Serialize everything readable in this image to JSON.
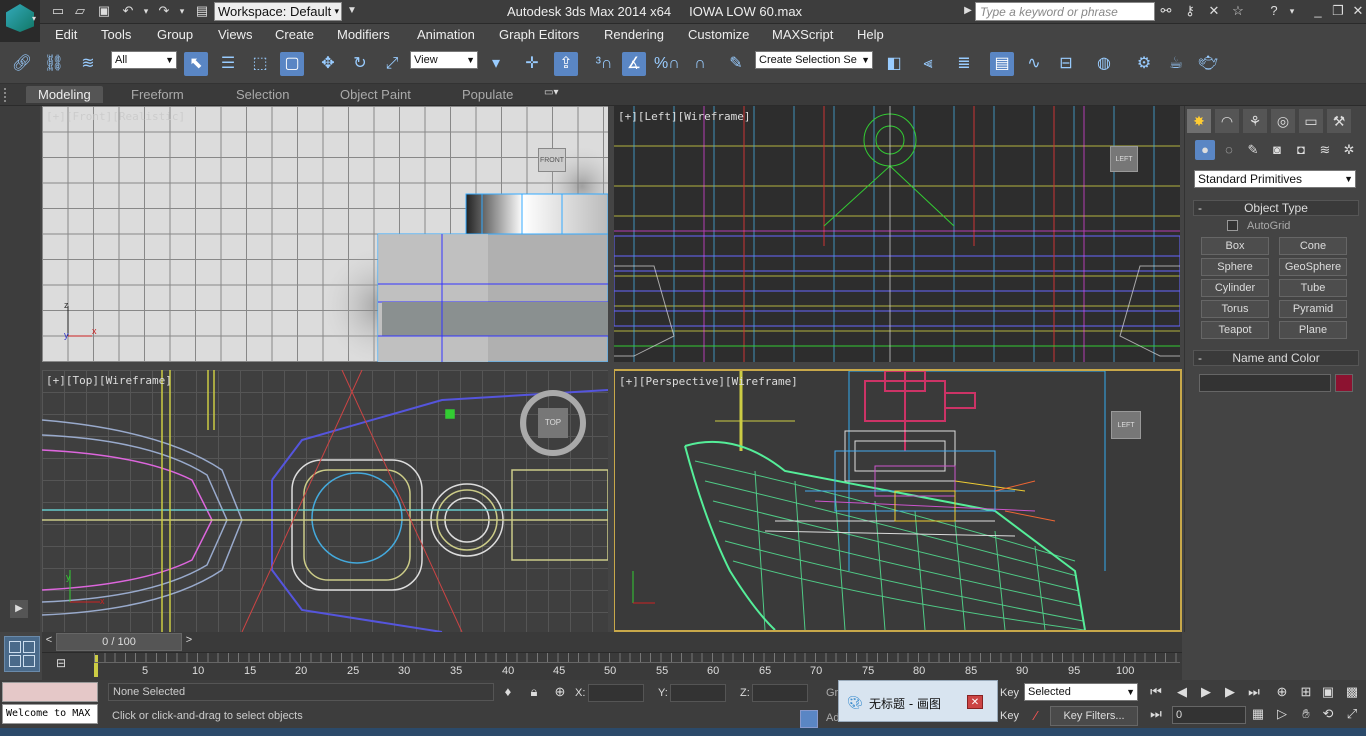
{
  "titlebar": {
    "workspace": "Workspace: Default",
    "app_title": "Autodesk 3ds Max  2014 x64",
    "file_name": "IOWA LOW 60.max",
    "search_placeholder": "Type a keyword or phrase"
  },
  "menu": [
    "Edit",
    "Tools",
    "Group",
    "Views",
    "Create",
    "Modifiers",
    "Animation",
    "Graph Editors",
    "Rendering",
    "Customize",
    "MAXScript",
    "Help"
  ],
  "toolbar": {
    "selection_filter": "All",
    "ref_coord": "View",
    "named_selection": "Create Selection Se"
  },
  "ribbon": {
    "tabs": [
      "Modeling",
      "Freeform",
      "Selection",
      "Object Paint",
      "Populate"
    ]
  },
  "viewports": {
    "front_label": "[+][Front][Realistic]",
    "front_cube": "FRONT",
    "left_label": "[+][Left][Wireframe]",
    "top_label": "[+][Top][Wireframe]",
    "top_cube": "TOP",
    "persp_label": "[+][Perspective][Wireframe]",
    "persp_cube": "LEFT",
    "left_cube": "LEFT"
  },
  "command_panel": {
    "category": "Standard Primitives",
    "object_type_header": "Object Type",
    "autogrid": "AutoGrid",
    "buttons": [
      "Box",
      "Cone",
      "Sphere",
      "GeoSphere",
      "Cylinder",
      "Tube",
      "Torus",
      "Pyramid",
      "Teapot",
      "Plane"
    ],
    "name_color_header": "Name and Color",
    "color": "#8c1230"
  },
  "timeline": {
    "frame_display": "0 / 100",
    "ticks": [
      "5",
      "10",
      "15",
      "20",
      "25",
      "30",
      "35",
      "40",
      "45",
      "50",
      "55",
      "60",
      "65",
      "70",
      "75",
      "80",
      "85",
      "90",
      "95",
      "100"
    ]
  },
  "status": {
    "script_listener": "Welcome to MAX",
    "selection": "None Selected",
    "prompt": "Click or click-and-drag to select objects",
    "x_label": "X:",
    "y_label": "Y:",
    "z_label": "Z:",
    "key_label": "Key",
    "key_mode": "Selected",
    "key_filters": "Key Filters...",
    "frame_field": "0",
    "grid_label": "Gr",
    "add_label": "Ad"
  },
  "popup": {
    "title": "无标题 - 画图"
  }
}
